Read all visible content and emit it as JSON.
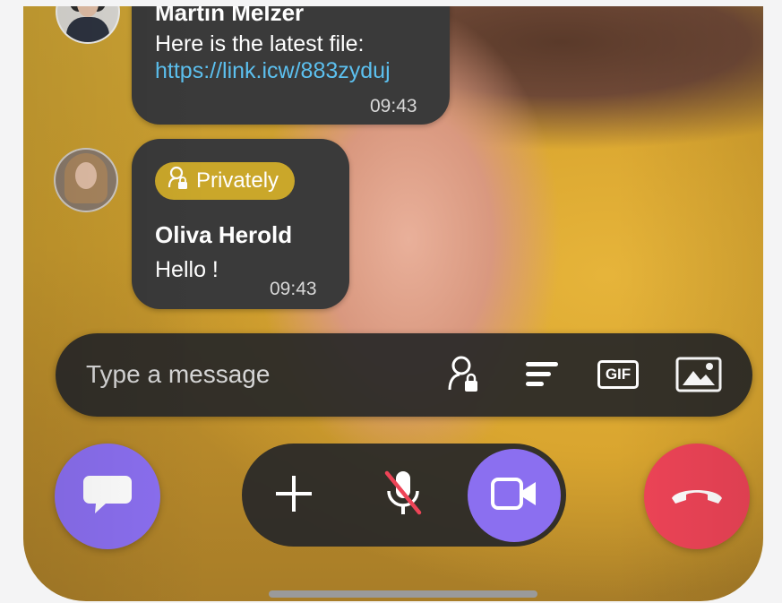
{
  "messages": [
    {
      "sender": "Martin Melzer",
      "text": "Here is the latest file:",
      "link": "https://link.icw/883zyduj",
      "time": "09:43"
    },
    {
      "badge": "Privately",
      "sender": "Oliva Herold",
      "text": "Hello !",
      "time": "09:43"
    }
  ],
  "composer": {
    "placeholder": "Type a message",
    "private_icon": "private-user-lock-icon",
    "format_icon": "text-format-icon",
    "gif_label": "GIF",
    "image_icon": "image-icon"
  },
  "call_controls": {
    "chat_icon": "chat-bubble-icon",
    "add_icon": "plus-icon",
    "mute_icon": "microphone-muted-icon",
    "video_icon": "video-camera-icon",
    "hangup_icon": "phone-hangup-icon"
  },
  "colors": {
    "accent_purple": "#8b6ff0",
    "hangup_red": "#ee4457",
    "private_badge": "#caa72a",
    "bubble_bg": "#3a3a3a",
    "link": "#5cc0ef"
  }
}
